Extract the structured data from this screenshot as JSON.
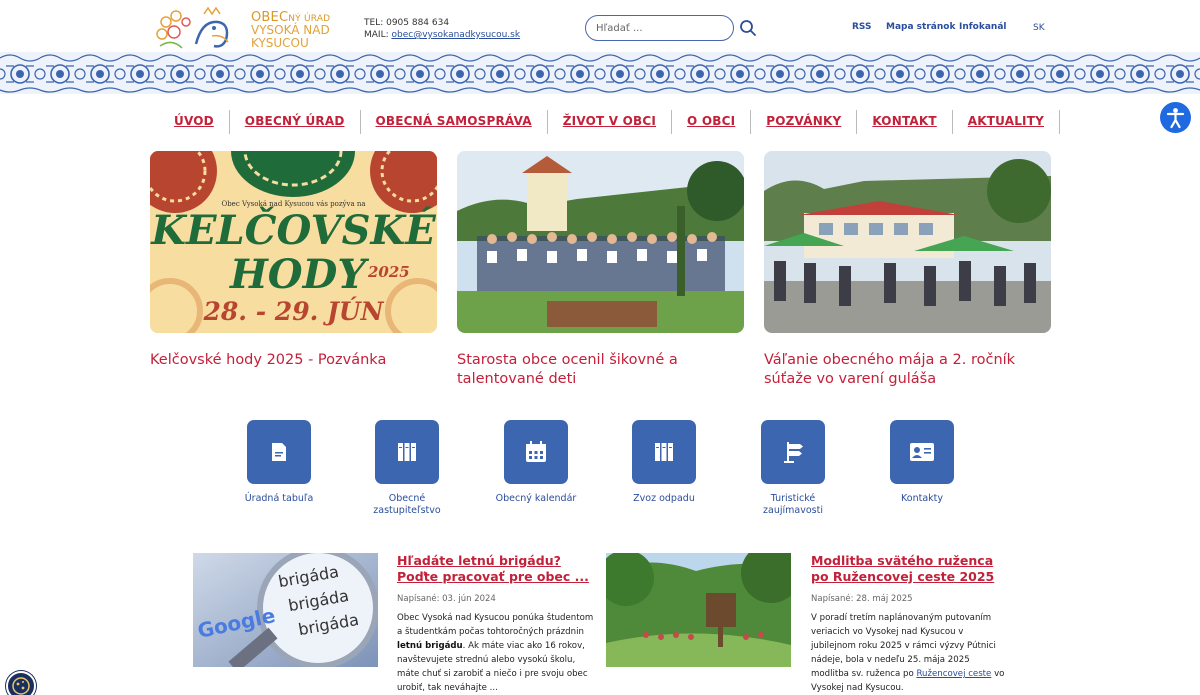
{
  "header": {
    "logo": {
      "line1_prefix": "OBEC",
      "line1_suffix": "NÝ ÚRAD",
      "line2": "VYSOKÁ NAD",
      "line3": "KYSUCOU"
    },
    "phone": "TEL: 0905 884 634",
    "mail_label": "MAIL: ",
    "mail": "obec@vysokanadkysucou.sk",
    "search_placeholder": "Hľadať ...",
    "links": [
      "RSS",
      "Mapa stránok",
      "Infokanál"
    ],
    "lang": "SK"
  },
  "nav": [
    "ÚVOD",
    "OBECNÝ ÚRAD",
    "OBECNÁ SAMOSPRÁVA",
    "ŽIVOT V OBCI",
    "O OBCI",
    "POZVÁNKY",
    "KONTAKT",
    "AKTUALITY"
  ],
  "poster": {
    "invite": "Obec Vysoká nad Kysucou vás pozýva na",
    "title1": "KELČOVSKÉ",
    "title2": "HODY",
    "year": "2025",
    "date": "28. - 29. JÚN"
  },
  "news": [
    {
      "title": "Kelčovské hody 2025 - Pozvánka"
    },
    {
      "title": "Starosta obce ocenil šikovné a talentované deti"
    },
    {
      "title": "Váľanie obecného mája a 2. ročník súťaže vo varení guláša"
    }
  ],
  "quicklinks": [
    {
      "label": "Úradná tabuľa",
      "icon": "document-icon"
    },
    {
      "label": "Obecné zastupiteľstvo",
      "icon": "binders-icon"
    },
    {
      "label": "Obecný kalendár",
      "icon": "calendar-icon"
    },
    {
      "label": "Zvoz odpadu",
      "icon": "binders-icon"
    },
    {
      "label": "Turistické zaujímavosti",
      "icon": "signpost-icon"
    },
    {
      "label": "Kontakty",
      "icon": "contact-card-icon"
    }
  ],
  "articles": [
    {
      "title": "Hľadáte letnú brigádu? Poďte pracovať pre obec ...",
      "date": "Napísané: 03. jún 2024",
      "text1": "Obec Vysoká nad Kysucou ponúka študentom a študentkám počas tohtoročných prázdnin ",
      "bold": "letnú brigádu",
      "text2": ". Ak máte viac ako 16 rokov, navštevujete strednú alebo vysokú školu, máte chuť si zarobiť a niečo i pre svoju obec urobiť, tak neváhajte ...",
      "img_words": [
        "brigáda",
        "brigáda",
        "brigáda",
        "Google"
      ]
    },
    {
      "title": "Modlitba svätého ruženca po Ružencovej ceste 2025",
      "date": "Napísané: 28. máj 2025",
      "text1": "V poradí tretím naplánovaným putovaním veriacich vo Vysokej nad Kysucou v jubilejnom roku 2025 v rámci výzvy Pútnici nádeje, bola v nedeľu 25. mája 2025 modlitba sv. ruženca po ",
      "link": "Ružencovej ceste",
      "text2": " vo Vysokej nad Kysucou."
    }
  ],
  "colors": {
    "accent_red": "#c3203a",
    "brand_blue": "#3d66b0",
    "link_blue": "#2a4d9c"
  }
}
